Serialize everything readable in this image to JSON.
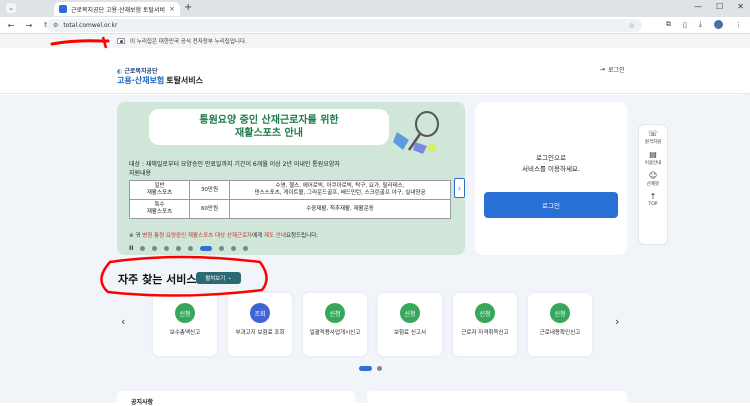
{
  "browser": {
    "tab_title": "근로복지공단 고용·산재보험 토탈서비스",
    "url": "total.comwel.or.kr",
    "new_tab_glyph": "+",
    "close_glyph": "×"
  },
  "gov_banner": {
    "text": "이 누리집은 대한민국 공식 전자정부 누리집입니다."
  },
  "header": {
    "org_name": "근로복지공단",
    "title_blue": "고용·산재보험",
    "title_black": "토탈서비스",
    "logout_label": "로그인"
  },
  "banner": {
    "title_line1": "통원요양 중인 산재근로자를 위한",
    "title_line2": "재활스포츠 안내",
    "target_line1": "대상 : 재해일로부터 요양승인 만료일까지 기간이 6개월 이상 2년 이내인 통원요양자",
    "target_line2": "지원내용",
    "table": [
      {
        "type": "일반\n재활스포츠",
        "amount": "30만원",
        "items": "수영, 헬스, 에어로빅, 아쿠아로빅, 탁구, 요가, 필라테스,\n댄스스포츠, 게이트볼, 그라운드골프, 배드민턴, 스크린골프 야구, 실내양궁"
      },
      {
        "type": "특수\n재활스포츠",
        "amount": "60만원",
        "items": "수중재활, 척추재활, 재활운동"
      }
    ],
    "note_prefix": "※ 귀",
    "note_red": "병원 통원 요양중인 재활스포츠 대상 산재근로자",
    "note_mid": "에게",
    "note_red2": "제도 안내",
    "note_suffix": "요청드립니다.",
    "pause_glyph": "II",
    "next_glyph": "›",
    "dots": [
      false,
      false,
      false,
      false,
      false,
      true,
      false,
      false,
      false
    ]
  },
  "login": {
    "line1": "로그인으로",
    "line2": "서비스를 이용하세요.",
    "button": "로그인"
  },
  "quick_menu": [
    {
      "icon": "headset-icon",
      "glyph": "☏",
      "label": "원격지원"
    },
    {
      "icon": "guide-icon",
      "glyph": "▤",
      "label": "이용안내"
    },
    {
      "icon": "chatbot-icon",
      "glyph": "☺",
      "label": "산재봇"
    },
    {
      "icon": "arrow-up-icon",
      "glyph": "↑",
      "label": "TOP"
    }
  ],
  "services": {
    "title": "자주 찾는 서비스",
    "toggle": "펼쳐보기",
    "prev_glyph": "‹",
    "next_glyph": "›",
    "cards": [
      {
        "badge": "신청",
        "label": "보수총액신고",
        "blue": false
      },
      {
        "badge": "조회",
        "label": "부과고지 보험료 조회",
        "blue": true
      },
      {
        "badge": "신청",
        "label": "일괄적용사업개시신고",
        "blue": false
      },
      {
        "badge": "신청",
        "label": "보험료 신고서",
        "blue": false
      },
      {
        "badge": "신청",
        "label": "근로자 자격취득신고",
        "blue": false
      },
      {
        "badge": "신청",
        "label": "근로내용확인신고",
        "blue": false
      }
    ]
  },
  "bottom": {
    "left_title": "공지사항"
  },
  "colors": {
    "accent": "#2970d4",
    "banner_green": "#1b7a4a",
    "annotation_red": "#ff0000"
  }
}
